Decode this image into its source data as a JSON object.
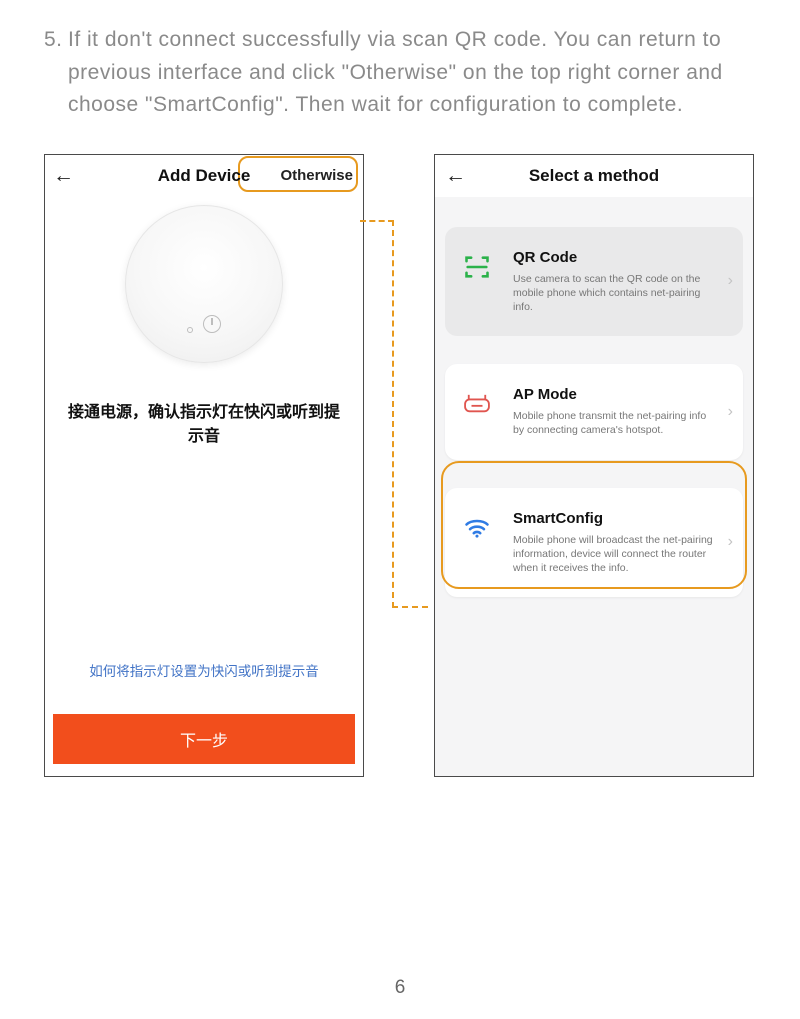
{
  "instruction": {
    "number": "5.",
    "text": "If it don't connect successfully via scan QR code. You can return to previous interface and click \"Otherwise\" on the top right corner and choose \"SmartConfig\". Then wait for configuration to complete."
  },
  "left_phone": {
    "back_glyph": "←",
    "title": "Add Device",
    "otherwise_label": "Otherwise",
    "hint_cn": "接通电源，确认指示灯在快闪或听到提示音",
    "link_cn": "如何将指示灯设置为快闪或听到提示音",
    "next_label": "下一步"
  },
  "right_phone": {
    "back_glyph": "←",
    "title": "Select a method",
    "methods": [
      {
        "id": "qr",
        "title": "QR Code",
        "desc": "Use camera to scan the QR code on the mobile phone which contains net-pairing info."
      },
      {
        "id": "ap",
        "title": "AP Mode",
        "desc": "Mobile phone transmit the net-pairing info by connecting camera's hotspot."
      },
      {
        "id": "smartconfig",
        "title": "SmartConfig",
        "desc": "Mobile phone will broadcast the net-pairing information, device will connect the router when it receives the info."
      }
    ],
    "chevron_glyph": "›"
  },
  "page_number": "6"
}
